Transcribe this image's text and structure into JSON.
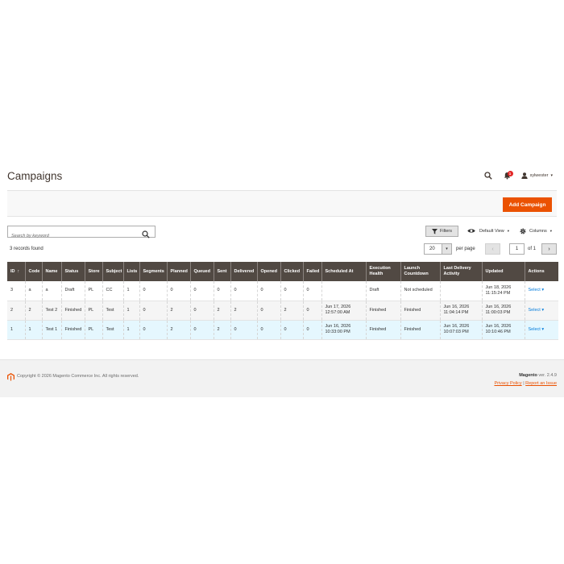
{
  "page": {
    "title": "Campaigns"
  },
  "header": {
    "notifications_count": "1",
    "username": "sylwester"
  },
  "actions": {
    "add_label": "Add Campaign"
  },
  "toolbar": {
    "search_placeholder": "Search by keyword",
    "filters_label": "Filters",
    "view_label": "Default View",
    "columns_label": "Columns",
    "records_found": "3 records found",
    "per_page_value": "20",
    "per_page_label": "per page",
    "page_number": "1",
    "page_of": "of 1"
  },
  "grid": {
    "columns": [
      "ID",
      "Code",
      "Name",
      "Status",
      "Store",
      "Subject",
      "Lists",
      "Segments",
      "Planned",
      "Queued",
      "Sent",
      "Delivered",
      "Opened",
      "Clicked",
      "Failed",
      "Scheduled At",
      "Execution Health",
      "Launch Countdown",
      "Last Delivery Activity",
      "Updated",
      "Actions"
    ],
    "rows": [
      [
        "3",
        "a",
        "a",
        "Draft",
        "PL",
        "CC",
        "1",
        "0",
        "0",
        "0",
        "0",
        "0",
        "0",
        "0",
        "0",
        "",
        "Draft",
        "Not scheduled",
        "",
        "Jun 18, 2026 11:15:24 PM",
        "Select"
      ],
      [
        "2",
        "2",
        "Test 2",
        "Finished",
        "PL",
        "Test",
        "1",
        "0",
        "2",
        "0",
        "2",
        "2",
        "0",
        "2",
        "0",
        "Jun 17, 2026 12:57:00 AM",
        "Finished",
        "Finished",
        "Jun 16, 2026 11:04:14 PM",
        "Jun 16, 2026 11:00:03 PM",
        "Select"
      ],
      [
        "1",
        "1",
        "Test 1",
        "Finished",
        "PL",
        "Test",
        "1",
        "0",
        "2",
        "0",
        "2",
        "0",
        "0",
        "0",
        "0",
        "Jun 16, 2026 10:33:00 PM",
        "Finished",
        "Finished",
        "Jun 16, 2026 10:07:03 PM",
        "Jun 16, 2026 10:10:46 PM",
        "Select"
      ]
    ]
  },
  "footer": {
    "copyright": "Copyright © 2026 Magento Commerce Inc. All rights reserved.",
    "brand": "Magento",
    "version": "ver. 2.4.9",
    "privacy_link": "Privacy Policy",
    "separator": "|",
    "report_link": "Report an Issue"
  },
  "colors": {
    "accent": "#eb5202",
    "grid_header_bg": "#514943",
    "link": "#007bdb",
    "badge": "#e22626"
  },
  "icons": [
    "search-icon",
    "bell-icon",
    "user-icon",
    "filter-icon",
    "eye-icon",
    "gear-icon",
    "magento-logo-icon"
  ]
}
